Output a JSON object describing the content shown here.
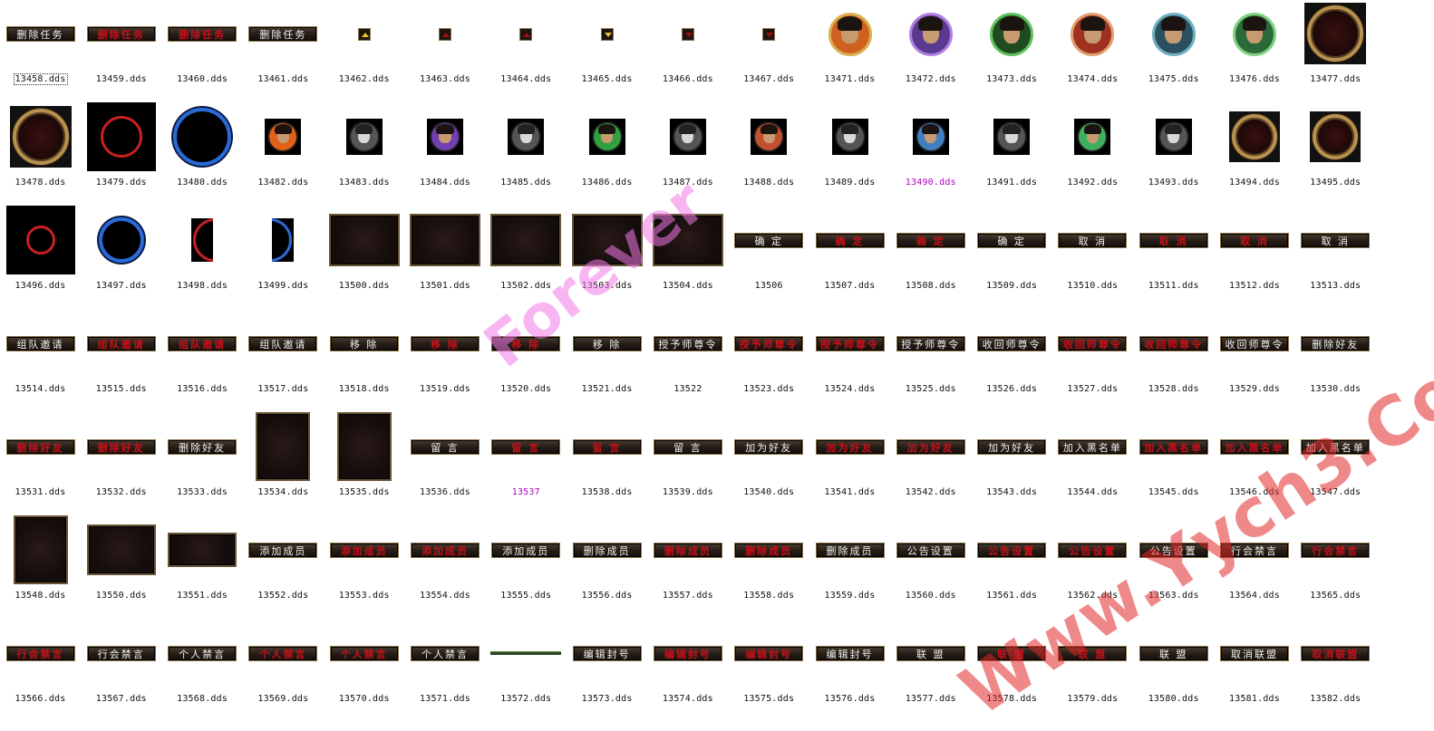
{
  "watermarks": [
    "Forever",
    "Www.Yych3.Com"
  ],
  "cells": [
    {
      "file": "13458.dds",
      "kind": "btn",
      "label": "删除任务",
      "sel": true
    },
    {
      "file": "13459.dds",
      "kind": "btnred",
      "label": "删除任务"
    },
    {
      "file": "13460.dds",
      "kind": "btnred",
      "label": "删除任务"
    },
    {
      "file": "13461.dds",
      "kind": "btn",
      "label": "删除任务"
    },
    {
      "file": "13462.dds",
      "kind": "arrow",
      "dir": "up"
    },
    {
      "file": "13463.dds",
      "kind": "arrow",
      "dir": "up",
      "red": true
    },
    {
      "file": "13464.dds",
      "kind": "arrow",
      "dir": "up",
      "red": true
    },
    {
      "file": "13465.dds",
      "kind": "arrow",
      "dir": "down"
    },
    {
      "file": "13466.dds",
      "kind": "arrow",
      "dir": "down",
      "red": true
    },
    {
      "file": "13467.dds",
      "kind": "arrow",
      "dir": "down",
      "red": true
    },
    {
      "file": "13471.dds",
      "kind": "face",
      "size": 48,
      "ring": "#d8b050",
      "bg": "#d06020"
    },
    {
      "file": "13472.dds",
      "kind": "face",
      "size": 48,
      "ring": "#b080e0",
      "bg": "#5a3a90"
    },
    {
      "file": "13473.dds",
      "kind": "face",
      "size": 48,
      "ring": "#60c060",
      "bg": "#204a20"
    },
    {
      "file": "13474.dds",
      "kind": "face",
      "size": 48,
      "ring": "#e0a070",
      "bg": "#a03020"
    },
    {
      "file": "13475.dds",
      "kind": "face",
      "size": 48,
      "ring": "#70b0c0",
      "bg": "#2a5060"
    },
    {
      "file": "13476.dds",
      "kind": "face",
      "size": 48,
      "ring": "#80d080",
      "bg": "#2a6a3a"
    },
    {
      "file": "13477.dds",
      "kind": "goldring",
      "size": 68
    },
    {
      "file": "13478.dds",
      "kind": "goldring",
      "size": 68
    },
    {
      "file": "13479.dds",
      "kind": "ringbox",
      "size": 76,
      "color": "#c82020",
      "inner": 46
    },
    {
      "file": "13480.dds",
      "kind": "ring",
      "size": 64,
      "color": "#2a6ad8"
    },
    {
      "file": "13482.dds",
      "kind": "facebox",
      "size": 40,
      "bg": "#e06018"
    },
    {
      "file": "13483.dds",
      "kind": "facebox",
      "size": 40,
      "gray": true
    },
    {
      "file": "13484.dds",
      "kind": "facebox",
      "size": 40,
      "bg": "#7040b0"
    },
    {
      "file": "13485.dds",
      "kind": "facebox",
      "size": 40,
      "gray": true
    },
    {
      "file": "13486.dds",
      "kind": "facebox",
      "size": 40,
      "bg": "#30a040"
    },
    {
      "file": "13487.dds",
      "kind": "facebox",
      "size": 40,
      "gray": true
    },
    {
      "file": "13488.dds",
      "kind": "facebox",
      "size": 40,
      "bg": "#c05030"
    },
    {
      "file": "13489.dds",
      "kind": "facebox",
      "size": 40,
      "gray": true
    },
    {
      "file": "13490.dds",
      "kind": "facebox",
      "size": 40,
      "bg": "#4080c0",
      "purple": true
    },
    {
      "file": "13491.dds",
      "kind": "facebox",
      "size": 40,
      "gray": true
    },
    {
      "file": "13492.dds",
      "kind": "facebox",
      "size": 40,
      "bg": "#40b060"
    },
    {
      "file": "13493.dds",
      "kind": "facebox",
      "size": 40,
      "gray": true
    },
    {
      "file": "13494.dds",
      "kind": "goldring",
      "size": 56
    },
    {
      "file": "13495.dds",
      "kind": "goldring",
      "size": 56
    },
    {
      "file": "13496.dds",
      "kind": "ringbox",
      "size": 76,
      "color": "#c82020",
      "inner": 32
    },
    {
      "file": "13497.dds",
      "kind": "ring",
      "size": 50,
      "color": "#2a6ad8"
    },
    {
      "file": "13498.dds",
      "kind": "halfring",
      "size": 48,
      "color": "#c82020",
      "side": "left"
    },
    {
      "file": "13499.dds",
      "kind": "halfring",
      "size": 48,
      "color": "#2a6ad8",
      "side": "right"
    },
    {
      "file": "13500.dds",
      "kind": "panel",
      "w": 78,
      "h": 58
    },
    {
      "file": "13501.dds",
      "kind": "panel",
      "w": 78,
      "h": 58
    },
    {
      "file": "13502.dds",
      "kind": "panel",
      "w": 78,
      "h": 58
    },
    {
      "file": "13503.dds",
      "kind": "panel",
      "w": 78,
      "h": 58
    },
    {
      "file": "13504.dds",
      "kind": "panel",
      "w": 78,
      "h": 58
    },
    {
      "file": "13506",
      "kind": "btn",
      "label": "确 定"
    },
    {
      "file": "13507.dds",
      "kind": "btnred",
      "label": "确 定"
    },
    {
      "file": "13508.dds",
      "kind": "btnred",
      "label": "确 定"
    },
    {
      "file": "13509.dds",
      "kind": "btn",
      "label": "确 定"
    },
    {
      "file": "13510.dds",
      "kind": "btn",
      "label": "取 消"
    },
    {
      "file": "13511.dds",
      "kind": "btnred",
      "label": "取 消"
    },
    {
      "file": "13512.dds",
      "kind": "btnred",
      "label": "取 消"
    },
    {
      "file": "13513.dds",
      "kind": "btn",
      "label": "取 消"
    },
    {
      "file": "13514.dds",
      "kind": "btn",
      "label": "组队邀请"
    },
    {
      "file": "13515.dds",
      "kind": "btnred",
      "label": "组队邀请"
    },
    {
      "file": "13516.dds",
      "kind": "btnred",
      "label": "组队邀请"
    },
    {
      "file": "13517.dds",
      "kind": "btn",
      "label": "组队邀请"
    },
    {
      "file": "13518.dds",
      "kind": "btn",
      "label": "移 除"
    },
    {
      "file": "13519.dds",
      "kind": "btnred",
      "label": "移 除"
    },
    {
      "file": "13520.dds",
      "kind": "btnred",
      "label": "移 除"
    },
    {
      "file": "13521.dds",
      "kind": "btn",
      "label": "移 除"
    },
    {
      "file": "13522",
      "kind": "btn",
      "label": "授予师尊令"
    },
    {
      "file": "13523.dds",
      "kind": "btnred",
      "label": "授予师尊令"
    },
    {
      "file": "13524.dds",
      "kind": "btnred",
      "label": "授予师尊令"
    },
    {
      "file": "13525.dds",
      "kind": "btn",
      "label": "授予师尊令"
    },
    {
      "file": "13526.dds",
      "kind": "btn",
      "label": "收回师尊令"
    },
    {
      "file": "13527.dds",
      "kind": "btnred",
      "label": "收回师尊令"
    },
    {
      "file": "13528.dds",
      "kind": "btnred",
      "label": "收回师尊令"
    },
    {
      "file": "13529.dds",
      "kind": "btn",
      "label": "收回师尊令"
    },
    {
      "file": "13530.dds",
      "kind": "btn",
      "label": "删除好友"
    },
    {
      "file": "13531.dds",
      "kind": "btnred",
      "label": "删除好友"
    },
    {
      "file": "13532.dds",
      "kind": "btnred",
      "label": "删除好友"
    },
    {
      "file": "13533.dds",
      "kind": "btn",
      "label": "删除好友"
    },
    {
      "file": "13534.dds",
      "kind": "panel",
      "w": 60,
      "h": 76
    },
    {
      "file": "13535.dds",
      "kind": "panel",
      "w": 60,
      "h": 76
    },
    {
      "file": "13536.dds",
      "kind": "btn",
      "label": "留 言"
    },
    {
      "file": "13537",
      "kind": "btnred",
      "label": "留 言",
      "purple": true
    },
    {
      "file": "13538.dds",
      "kind": "btnred",
      "label": "留 言"
    },
    {
      "file": "13539.dds",
      "kind": "btn",
      "label": "留 言"
    },
    {
      "file": "13540.dds",
      "kind": "btn",
      "label": "加为好友"
    },
    {
      "file": "13541.dds",
      "kind": "btnred",
      "label": "加为好友"
    },
    {
      "file": "13542.dds",
      "kind": "btnred",
      "label": "加为好友"
    },
    {
      "file": "13543.dds",
      "kind": "btn",
      "label": "加为好友"
    },
    {
      "file": "13544.dds",
      "kind": "btn",
      "label": "加入黑名单"
    },
    {
      "file": "13545.dds",
      "kind": "btnred",
      "label": "加入黑名单"
    },
    {
      "file": "13546.dds",
      "kind": "btnred",
      "label": "加入黑名单"
    },
    {
      "file": "13547.dds",
      "kind": "btn",
      "label": "加入黑名单"
    },
    {
      "file": "13548.dds",
      "kind": "panel",
      "w": 60,
      "h": 76
    },
    {
      "file": "13550.dds",
      "kind": "panel",
      "w": 76,
      "h": 56
    },
    {
      "file": "13551.dds",
      "kind": "panel",
      "w": 76,
      "h": 38
    },
    {
      "file": "13552.dds",
      "kind": "btn",
      "label": "添加成员"
    },
    {
      "file": "13553.dds",
      "kind": "btnred",
      "label": "添加成员"
    },
    {
      "file": "13554.dds",
      "kind": "btnred",
      "label": "添加成员"
    },
    {
      "file": "13555.dds",
      "kind": "btn",
      "label": "添加成员"
    },
    {
      "file": "13556.dds",
      "kind": "btn",
      "label": "删除成员"
    },
    {
      "file": "13557.dds",
      "kind": "btnred",
      "label": "删除成员"
    },
    {
      "file": "13558.dds",
      "kind": "btnred",
      "label": "删除成员"
    },
    {
      "file": "13559.dds",
      "kind": "btn",
      "label": "删除成员"
    },
    {
      "file": "13560.dds",
      "kind": "btn",
      "label": "公告设置"
    },
    {
      "file": "13561.dds",
      "kind": "btnred",
      "label": "公告设置"
    },
    {
      "file": "13562.dds",
      "kind": "btnred",
      "label": "公告设置"
    },
    {
      "file": "13563.dds",
      "kind": "btn",
      "label": "公告设置"
    },
    {
      "file": "13564.dds",
      "kind": "btn",
      "label": "行会禁言"
    },
    {
      "file": "13565.dds",
      "kind": "btnred",
      "label": "行会禁言"
    },
    {
      "file": "13566.dds",
      "kind": "btnred",
      "label": "行会禁言"
    },
    {
      "file": "13567.dds",
      "kind": "btn",
      "label": "行会禁言"
    },
    {
      "file": "13568.dds",
      "kind": "btn",
      "label": "个人禁言"
    },
    {
      "file": "13569.dds",
      "kind": "btnred",
      "label": "个人禁言"
    },
    {
      "file": "13570.dds",
      "kind": "btnred",
      "label": "个人禁言"
    },
    {
      "file": "13571.dds",
      "kind": "btn",
      "label": "个人禁言"
    },
    {
      "file": "13572.dds",
      "kind": "bar"
    },
    {
      "file": "13573.dds",
      "kind": "btn",
      "label": "编辑封号"
    },
    {
      "file": "13574.dds",
      "kind": "btnred",
      "label": "编辑封号"
    },
    {
      "file": "13575.dds",
      "kind": "btnred",
      "label": "编辑封号"
    },
    {
      "file": "13576.dds",
      "kind": "btn",
      "label": "编辑封号"
    },
    {
      "file": "13577.dds",
      "kind": "btn",
      "label": "联 盟"
    },
    {
      "file": "13578.dds",
      "kind": "btnred",
      "label": "联 盟"
    },
    {
      "file": "13579.dds",
      "kind": "btnred",
      "label": "联 盟"
    },
    {
      "file": "13580.dds",
      "kind": "btn",
      "label": "联 盟"
    },
    {
      "file": "13581.dds",
      "kind": "btn",
      "label": "取消联盟"
    },
    {
      "file": "13582.dds",
      "kind": "btnred",
      "label": "取消联盟"
    }
  ]
}
